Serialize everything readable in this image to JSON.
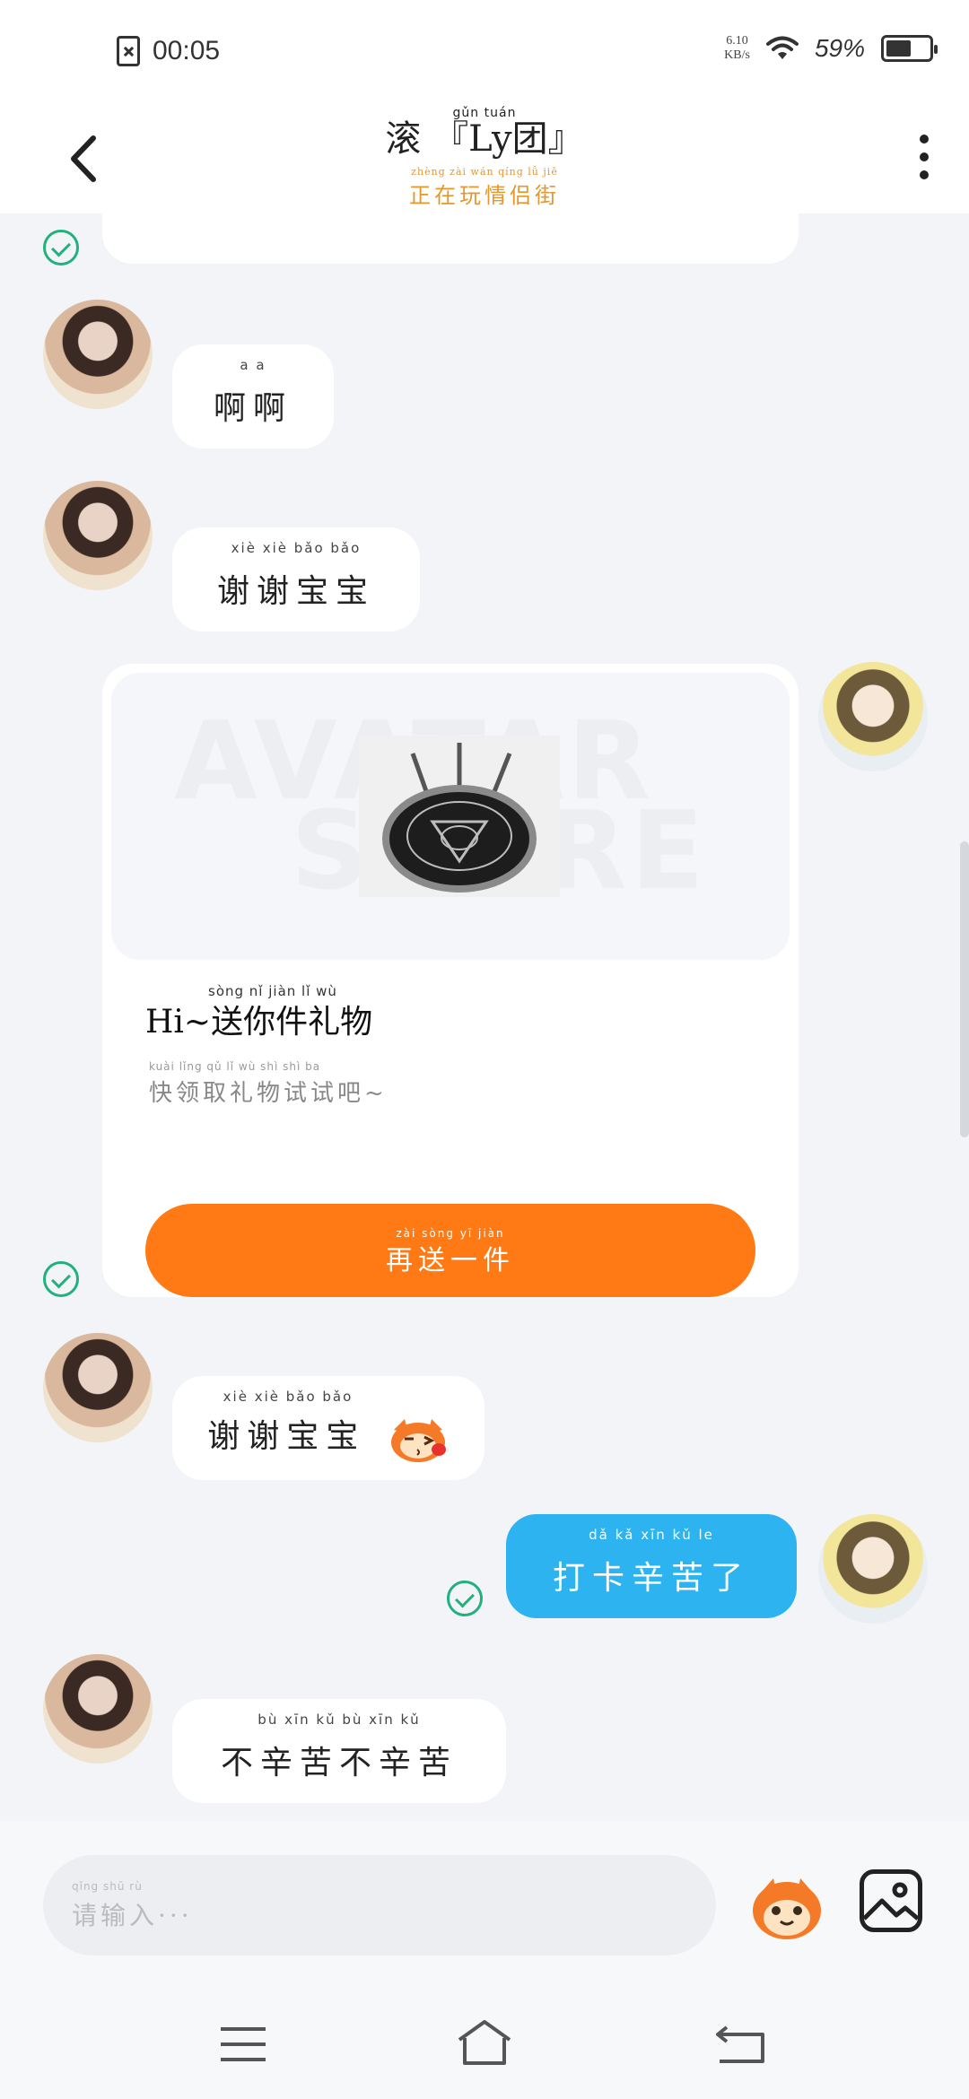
{
  "status_bar": {
    "time": "00:05",
    "net_speed_value": "6.10",
    "net_speed_unit": "KB/s",
    "battery_percent": "59%",
    "battery_level": 0.59,
    "icons": [
      "sim-error-icon",
      "wifi-icon",
      "battery-icon"
    ]
  },
  "header": {
    "title": "滚 『Ly团』",
    "title_pinyin": "gǔn                         tuán",
    "subtitle": "正在玩情侣街",
    "subtitle_pinyin": "zhèng zài wán qíng lǚ jiē",
    "subtitle_color": "#e6972c",
    "icons": [
      "back-arrow-icon",
      "more-vertical-icon"
    ]
  },
  "messages": [
    {
      "pinyin": "a    a",
      "text": "啊啊"
    },
    {
      "pinyin": "xiè xiè bǎo bǎo",
      "text": "谢谢宝宝"
    },
    {
      "pinyin": "xiè xiè bǎo bǎo",
      "text": "谢谢宝宝"
    },
    {
      "pinyin": "dǎ  kǎ  xīn  kǔ  le",
      "text": "打卡辛苦了"
    },
    {
      "pinyin": "bù xīn kǔ bù xīn kǔ",
      "text": "不辛苦不辛苦"
    }
  ],
  "gift_card": {
    "watermark_top": "AVATAR",
    "watermark_bottom": "STORE",
    "title": "Hi~送你件礼物",
    "title_pinyin": "sòng   nǐ   jiàn   lǐ   wù",
    "description": "快领取礼物试试吧~",
    "description_pinyin": "kuài  lǐng  qǔ   lǐ   wù  shì  shì  ba",
    "button_label": "再送一件",
    "button_pinyin": "zài sòng yī jiàn",
    "button_color": "#ff7a14"
  },
  "input": {
    "placeholder": "请输入···",
    "placeholder_pinyin": "qǐng shū rù",
    "icons": [
      "emoji-mascot-icon",
      "image-icon"
    ]
  },
  "nav": {
    "icons": [
      "menu-icon",
      "home-icon",
      "back-icon"
    ]
  },
  "colors": {
    "mine_bubble": "#2db3f0",
    "sent_check": "#22b07d",
    "chat_background": "#f2f4f8"
  }
}
